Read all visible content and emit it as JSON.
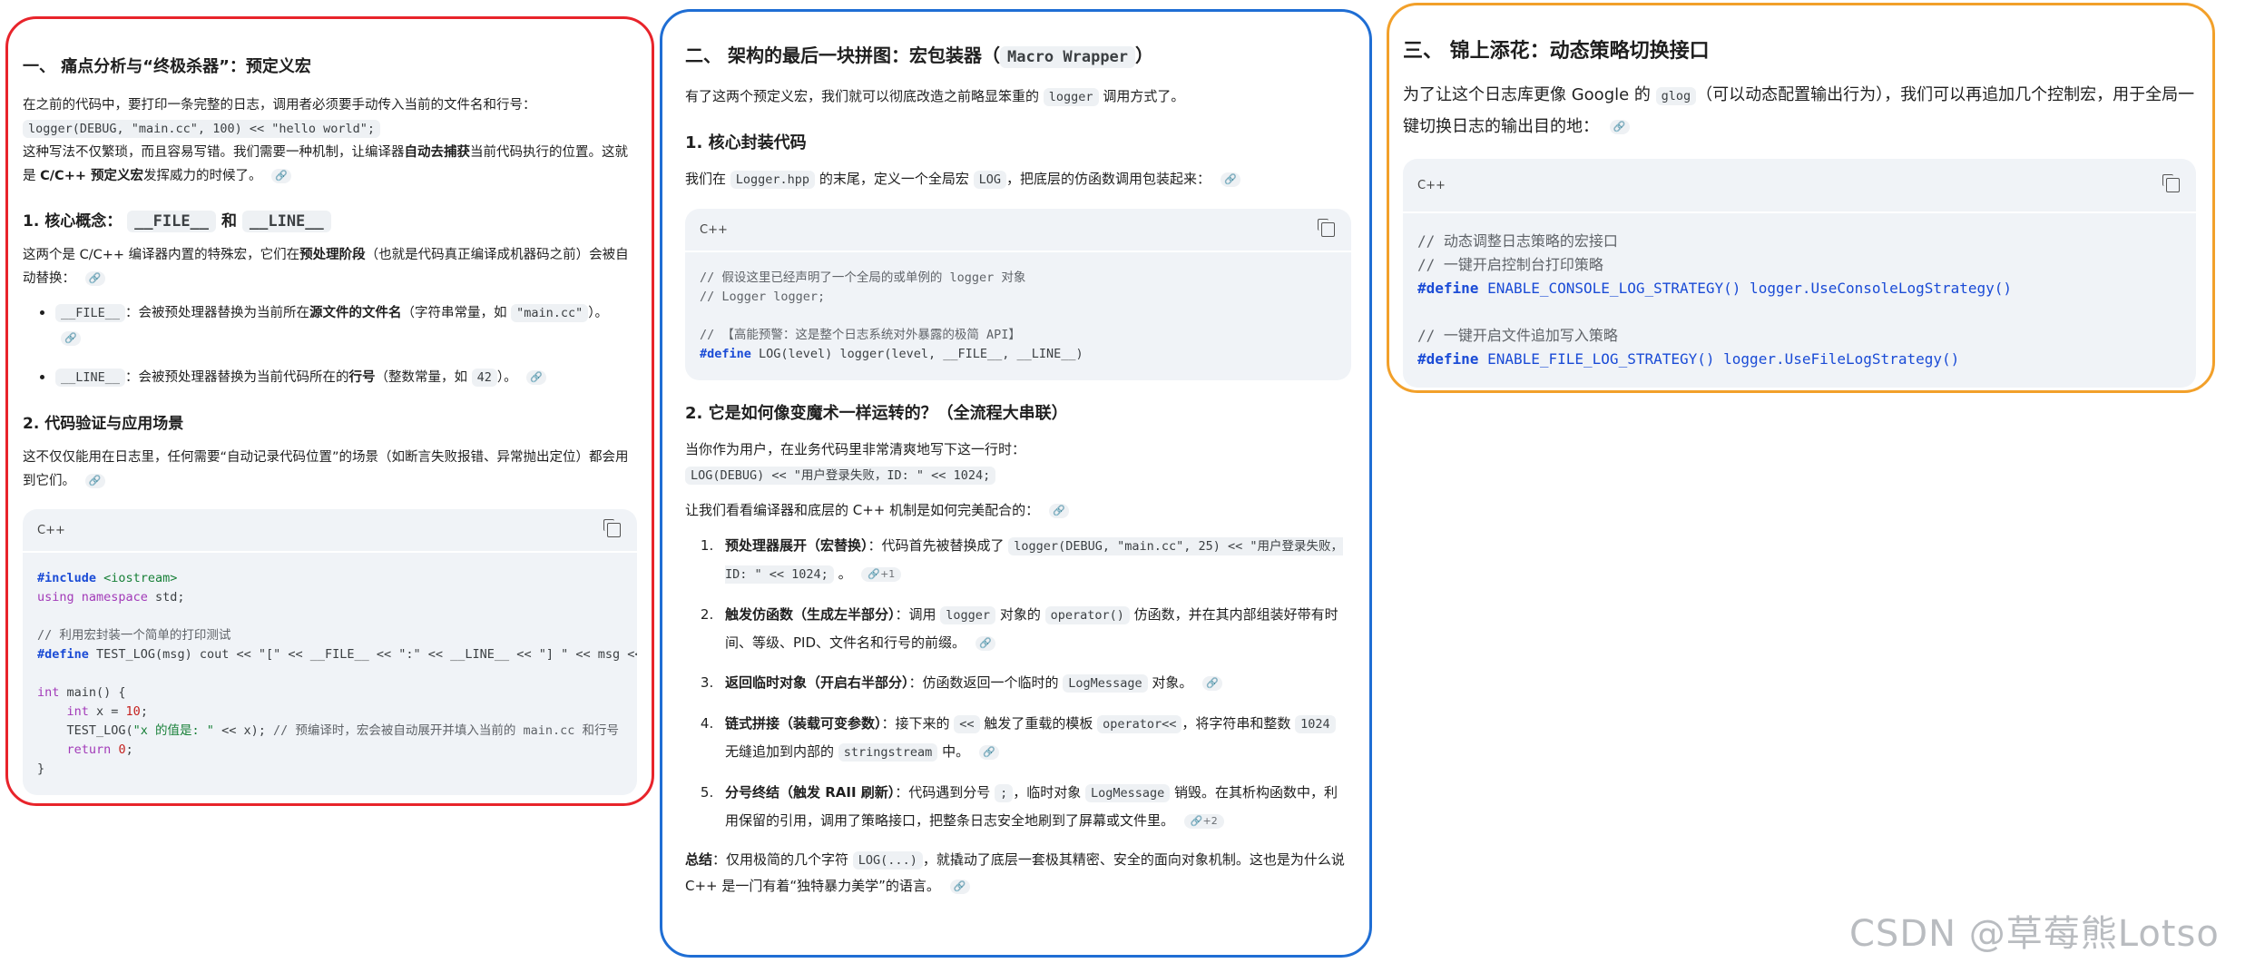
{
  "colors": {
    "panel1_border": "#e8242b",
    "panel2_border": "#1f6ed4",
    "panel3_border": "#f2a02a"
  },
  "panel1": {
    "title": "一、 痛点分析与“终极杀器”：预定义宏",
    "intro_1": "在之前的代码中，要打印一条完整的日志，调用者必须要手动传入当前的文件名和行号：",
    "intro_code": "logger(DEBUG, \"main.cc\", 100) << \"hello world\";",
    "intro_2a": "这种写法不仅繁琐，而且容易写错。我们需要一种机制，让编译器",
    "intro_2b": "自动去捕获",
    "intro_2c": "当前代码执行的位置。这就是 ",
    "intro_2d": "C/C++ 预定义宏",
    "intro_2e": "发挥威力的时候了。",
    "h_concept_prefix": "1. 核心概念：",
    "h_concept_file": "__FILE__",
    "h_concept_and": " 和 ",
    "h_concept_line": "__LINE__",
    "concept_a": "这两个是 C/C++ 编译器内置的特殊宏，它们在",
    "concept_b": "预处理阶段",
    "concept_c": "（也就是代码真正编译成机器码之前）会被自动替换：",
    "bullet1_code": "__FILE__",
    "bullet1_a": "：会被预处理器替换为当前所在",
    "bullet1_b": "源文件的文件名",
    "bullet1_c": "（字符串常量，如 ",
    "bullet1_code2": "\"main.cc\"",
    "bullet1_d": "）。",
    "bullet2_code": "__LINE__",
    "bullet2_a": "：会被预处理器替换为当前代码所在的",
    "bullet2_b": "行号",
    "bullet2_c": "（整数常量，如 ",
    "bullet2_code2": "42",
    "bullet2_d": "）。",
    "h_verify": "2. 代码验证与应用场景",
    "verify": "这不仅仅能用在日志里，任何需要“自动记录代码位置”的场景（如断言失败报错、异常抛出定位）都会用到它们。",
    "code_lang": "C++",
    "code": {
      "l1_kw": "#include",
      "l1_rest": " <iostream>",
      "l2_kw": "using namespace",
      "l2_rest": " std;",
      "l4": "// 利用宏封装一个简单的打印测试",
      "l5_kw": "#define",
      "l5_rest": " TEST_LOG(msg) cout << \"[\" << __FILE__ << \":\" << __LINE__ << \"] \" << msg << endl",
      "l7_ty": "int",
      "l7_rest": " main() {",
      "l8_ty": "int",
      "l8_a": " x = ",
      "l8_num": "10",
      "l8_b": ";",
      "l9_a": "TEST_LOG(",
      "l9_str": "\"x 的值是: \"",
      "l9_b": " << x); ",
      "l9_cm": "// 预编译时，宏会被自动展开并填入当前的 main.cc 和行号",
      "l10_kw": "return",
      "l10_num": "0",
      "l10_b": ";",
      "l11": "}"
    }
  },
  "panel2": {
    "title_a": "二、 架构的最后一块拼图：宏包装器（",
    "title_code": "Macro Wrapper",
    "title_b": "）",
    "intro_a": "有了这两个预定义宏，我们就可以彻底改造之前略显笨重的 ",
    "intro_code": "logger",
    "intro_b": " 调用方式了。",
    "h_core": "1. 核心封装代码",
    "core_a": "我们在 ",
    "core_code1": "Logger.hpp",
    "core_b": " 的末尾，定义一个全局宏 ",
    "core_code2": "LOG",
    "core_c": "，把底层的仿函数调用包装起来：",
    "code_lang": "C++",
    "code": {
      "c1": "// 假设这里已经声明了一个全局的或单例的 logger 对象",
      "c2": "// Logger logger;",
      "c3": "// 【高能预警：这是整个日志系统对外暴露的极简 API】",
      "d_kw": "#define",
      "d_rest": " LOG(level) logger(level, __FILE__, __LINE__)"
    },
    "h_magic": "2. 它是如何像变魔术一样运转的？（全流程大串联）",
    "magic_1": "当你作为用户，在业务代码里非常清爽地写下这一行时：",
    "magic_code": "LOG(DEBUG) << \"用户登录失败，ID: \" << 1024;",
    "magic_2": "让我们看看编译器和底层的 C++ 机制是如何完美配合的：",
    "steps": [
      {
        "title": "预处理器展开（宏替换）",
        "a": "：代码首先被替换成了 ",
        "code": "logger(DEBUG, \"main.cc\", 25) << \"用户登录失败，ID: \" << 1024;",
        "b": " 。",
        "badge": "+1"
      },
      {
        "title": "触发仿函数（生成左半部分）",
        "a": "：调用 ",
        "code": "logger",
        "b": " 对象的 ",
        "code2": "operator()",
        "c": " 仿函数，并在其内部组装好带有时间、等级、PID、文件名和行号的前缀。"
      },
      {
        "title": "返回临时对象（开启右半部分）",
        "a": "：仿函数返回一个临时的 ",
        "code": "LogMessage",
        "b": " 对象。"
      },
      {
        "title": "链式拼接（装载可变参数）",
        "a": "：接下来的 ",
        "code": "<<",
        "b": " 触发了重载的模板 ",
        "code2": "operator<<",
        "c": "，将字符串和整数 ",
        "code3": "1024",
        "d": " 无缝追加到内部的 ",
        "code4": "stringstream",
        "e": " 中。"
      },
      {
        "title": "分号终结（触发 RAII 刷新）",
        "a": "：代码遇到分号 ",
        "code": ";",
        "b": "，临时对象 ",
        "code2": "LogMessage",
        "c": " 销毁。在其析构函数中，利用保留的引用，调用了策略接口，把整条日志安全地刷到了屏幕或文件里。",
        "badge": "+2"
      }
    ],
    "summary_label": "总结",
    "summary_a": "：仅用极简的几个字符 ",
    "summary_code": "LOG(...)",
    "summary_b": "，就撬动了底层一套极其精密、安全的面向对象机制。这也是为什么说 C++ 是一门有着“独特暴力美学”的语言。"
  },
  "panel3": {
    "title": "三、 锦上添花：动态策略切换接口",
    "intro_a": "为了让这个日志库更像 Google 的 ",
    "intro_code": "glog",
    "intro_b": "（可以动态配置输出行为），我们可以再追加几个控制宏，用于全局一键切换日志的输出目的地：",
    "code_lang": "C++",
    "code": {
      "c1": "// 动态调整日志策略的宏接口",
      "c2": "// 一键开启控制台打印策略",
      "d1_kw": "#define",
      "d1_rest": " ENABLE_CONSOLE_LOG_STRATEGY() logger.UseConsoleLogStrategy()",
      "c3": "// 一键开启文件追加写入策略",
      "d2_kw": "#define",
      "d2_rest": " ENABLE_FILE_LOG_STRATEGY() logger.UseFileLogStrategy()"
    }
  },
  "watermark": "CSDN @草莓熊Lotso"
}
